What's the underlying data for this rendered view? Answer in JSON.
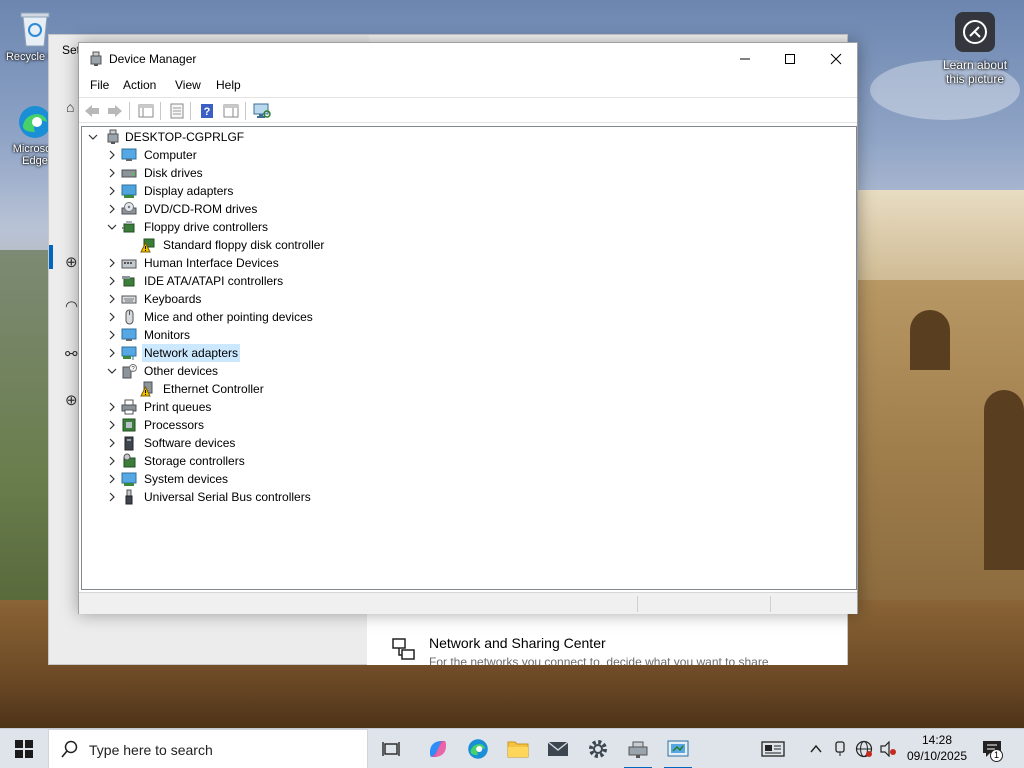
{
  "desktop": {
    "icons": [
      {
        "label": "Recycle Bin"
      },
      {
        "label": "Microsoft Edge"
      }
    ],
    "learn_about": "Learn about this picture"
  },
  "settings_window": {
    "title": "Settings",
    "network_sharing": {
      "title": "Network and Sharing Center",
      "subtitle": "For the networks you connect to, decide what you want to share"
    }
  },
  "device_manager": {
    "title": "Device Manager",
    "menu": [
      "File",
      "Action",
      "View",
      "Help"
    ],
    "toolbar": [
      "back-arrow-icon",
      "forward-arrow-icon",
      "show-hide-console-tree-icon",
      "properties-icon",
      "help-icon",
      "action-pane-icon",
      "scan-hardware-icon"
    ],
    "root": "DESKTOP-CGPRLGF",
    "tree": [
      {
        "label": "Computer",
        "expanded": false
      },
      {
        "label": "Disk drives",
        "expanded": false
      },
      {
        "label": "Display adapters",
        "expanded": false
      },
      {
        "label": "DVD/CD-ROM drives",
        "expanded": false
      },
      {
        "label": "Floppy drive controllers",
        "expanded": true,
        "children": [
          {
            "label": "Standard floppy disk controller",
            "warning": true
          }
        ]
      },
      {
        "label": "Human Interface Devices",
        "expanded": false
      },
      {
        "label": "IDE ATA/ATAPI controllers",
        "expanded": false
      },
      {
        "label": "Keyboards",
        "expanded": false
      },
      {
        "label": "Mice and other pointing devices",
        "expanded": false
      },
      {
        "label": "Monitors",
        "expanded": false
      },
      {
        "label": "Network adapters",
        "expanded": false,
        "selected": true
      },
      {
        "label": "Other devices",
        "expanded": true,
        "children": [
          {
            "label": "Ethernet Controller",
            "warning": true
          }
        ]
      },
      {
        "label": "Print queues",
        "expanded": false
      },
      {
        "label": "Processors",
        "expanded": false
      },
      {
        "label": "Software devices",
        "expanded": false
      },
      {
        "label": "Storage controllers",
        "expanded": false
      },
      {
        "label": "System devices",
        "expanded": false
      },
      {
        "label": "Universal Serial Bus controllers",
        "expanded": false
      }
    ]
  },
  "taskbar": {
    "search_placeholder": "Type here to search",
    "time": "14:28",
    "date": "09/10/2025",
    "notification_count": "1"
  },
  "colors": {
    "accent": "#0067c0",
    "selection": "#cce8ff",
    "warning": "#f2c200"
  }
}
